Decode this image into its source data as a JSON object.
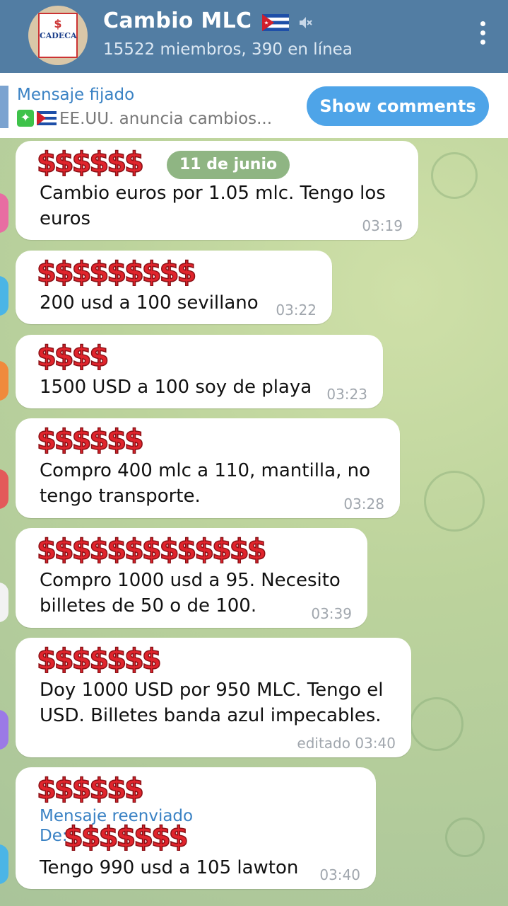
{
  "header": {
    "title": "Cambio MLC",
    "subtitle": "15522 miembros, 390 en línea",
    "avatar_text": "CADECA",
    "avatar_glyph": "$",
    "icons": [
      "cuba-flag-icon",
      "muted-icon",
      "more-vert-icon"
    ],
    "accent_color": "#527da3"
  },
  "pinned": {
    "label": "Mensaje fijado",
    "preview": "EE.UU. anuncia cambios...",
    "show_comments_label": "Show comments"
  },
  "date_divider": "11 de junio",
  "messages": [
    {
      "sender": "$$$$$$",
      "text": [
        "Cambio euros por 1.05 mlc. Tengo los",
        "euros"
      ],
      "time": "03:19"
    },
    {
      "sender": "$$$$$$$$$",
      "text": [
        "200 usd a 100 sevillano"
      ],
      "time": "03:22"
    },
    {
      "sender": "$$$$",
      "text": [
        "1500 USD a 100 soy de playa"
      ],
      "time": "03:23"
    },
    {
      "sender": "$$$$$$",
      "text": [
        "Compro 400 mlc a 110, mantilla, no",
        "tengo transporte."
      ],
      "time": "03:28"
    },
    {
      "sender": "$$$$$$$$$$$$$",
      "text": [
        "Compro 1000 usd a 95. Necesito",
        "billetes de 50 o de 100."
      ],
      "time": "03:39"
    },
    {
      "sender": "$$$$$$$",
      "text": [
        "Doy 1000 USD por 950 MLC. Tengo el",
        "USD. Billetes banda azul impecables."
      ],
      "time": "editado 03:40"
    },
    {
      "sender": "$$$$$$",
      "forward_label": "Mensaje reenviado",
      "forward_from": "De:",
      "forward_sender": "$$$$$$$",
      "text": [
        "Tengo 990 usd a 105 lawton"
      ],
      "time": "03:40"
    }
  ]
}
